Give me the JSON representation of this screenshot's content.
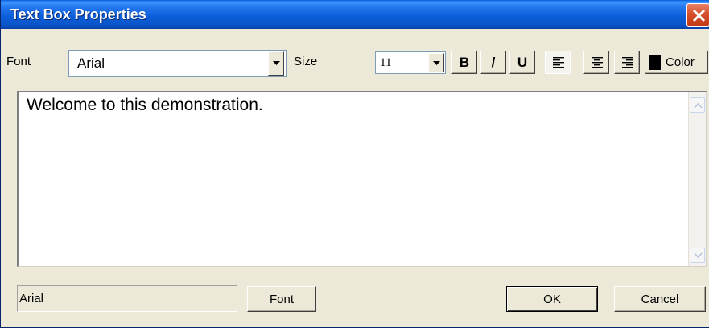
{
  "window": {
    "title": "Text Box Properties"
  },
  "toolbar": {
    "font_label": "Font",
    "font_value": "Arial",
    "size_label": "Size",
    "size_value": "11",
    "bold_label": "B",
    "italic_label": "/",
    "underline_label": "U",
    "color_label": "Color",
    "color_swatch": "#000000"
  },
  "editor": {
    "text": "Welcome to this demonstration."
  },
  "footer": {
    "font_display": "Arial",
    "font_button": "Font",
    "ok_button": "OK",
    "cancel_button": "Cancel"
  },
  "icons": [
    "close-icon",
    "dropdown-arrow-icon",
    "align-left-icon",
    "align-center-icon",
    "align-right-icon",
    "scroll-up-arrow-icon",
    "scroll-down-arrow-icon"
  ]
}
